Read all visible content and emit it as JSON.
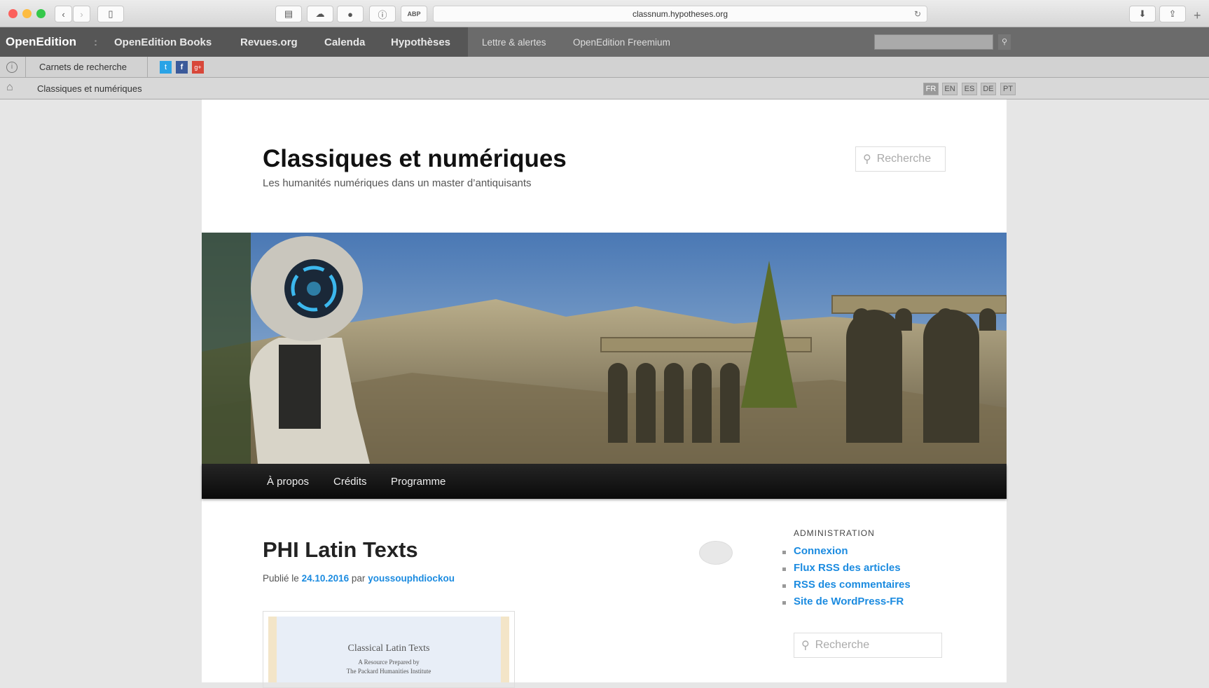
{
  "browser": {
    "url": "classnum.hypotheses.org"
  },
  "oe_nav": {
    "brand": "OpenEdition",
    "sep": ":",
    "items": [
      "OpenEdition Books",
      "Revues.org",
      "Calenda",
      "Hypothèses"
    ],
    "secondary": [
      "Lettre & alertes",
      "OpenEdition Freemium"
    ]
  },
  "bar2": {
    "label": "Carnets de recherche",
    "social": [
      "t",
      "f",
      "g+"
    ]
  },
  "breadcrumb": {
    "label": "Classiques et numériques",
    "langs": [
      "FR",
      "EN",
      "ES",
      "DE",
      "PT"
    ]
  },
  "site": {
    "title": "Classiques et numériques",
    "subtitle": "Les humanités numériques dans un master d’antiquisants",
    "search_placeholder": "Recherche"
  },
  "menu": [
    "À propos",
    "Crédits",
    "Programme"
  ],
  "post": {
    "title": "PHI Latin Texts",
    "published_prefix": "Publié le",
    "date": "24.10.2016",
    "by": "par",
    "author": "youssouphdiockou",
    "image": {
      "title": "Classical Latin Texts",
      "line1": "A Resource Prepared by",
      "line2": "The Packard Humanities Institute"
    }
  },
  "sidebar": {
    "heading": "ADMINISTRATION",
    "links": [
      "Connexion",
      "Flux RSS des articles",
      "RSS des commentaires",
      "Site de WordPress-FR"
    ],
    "search_placeholder": "Recherche"
  },
  "colors": {
    "link": "#1b8be0",
    "nav_bg": "#111111"
  }
}
